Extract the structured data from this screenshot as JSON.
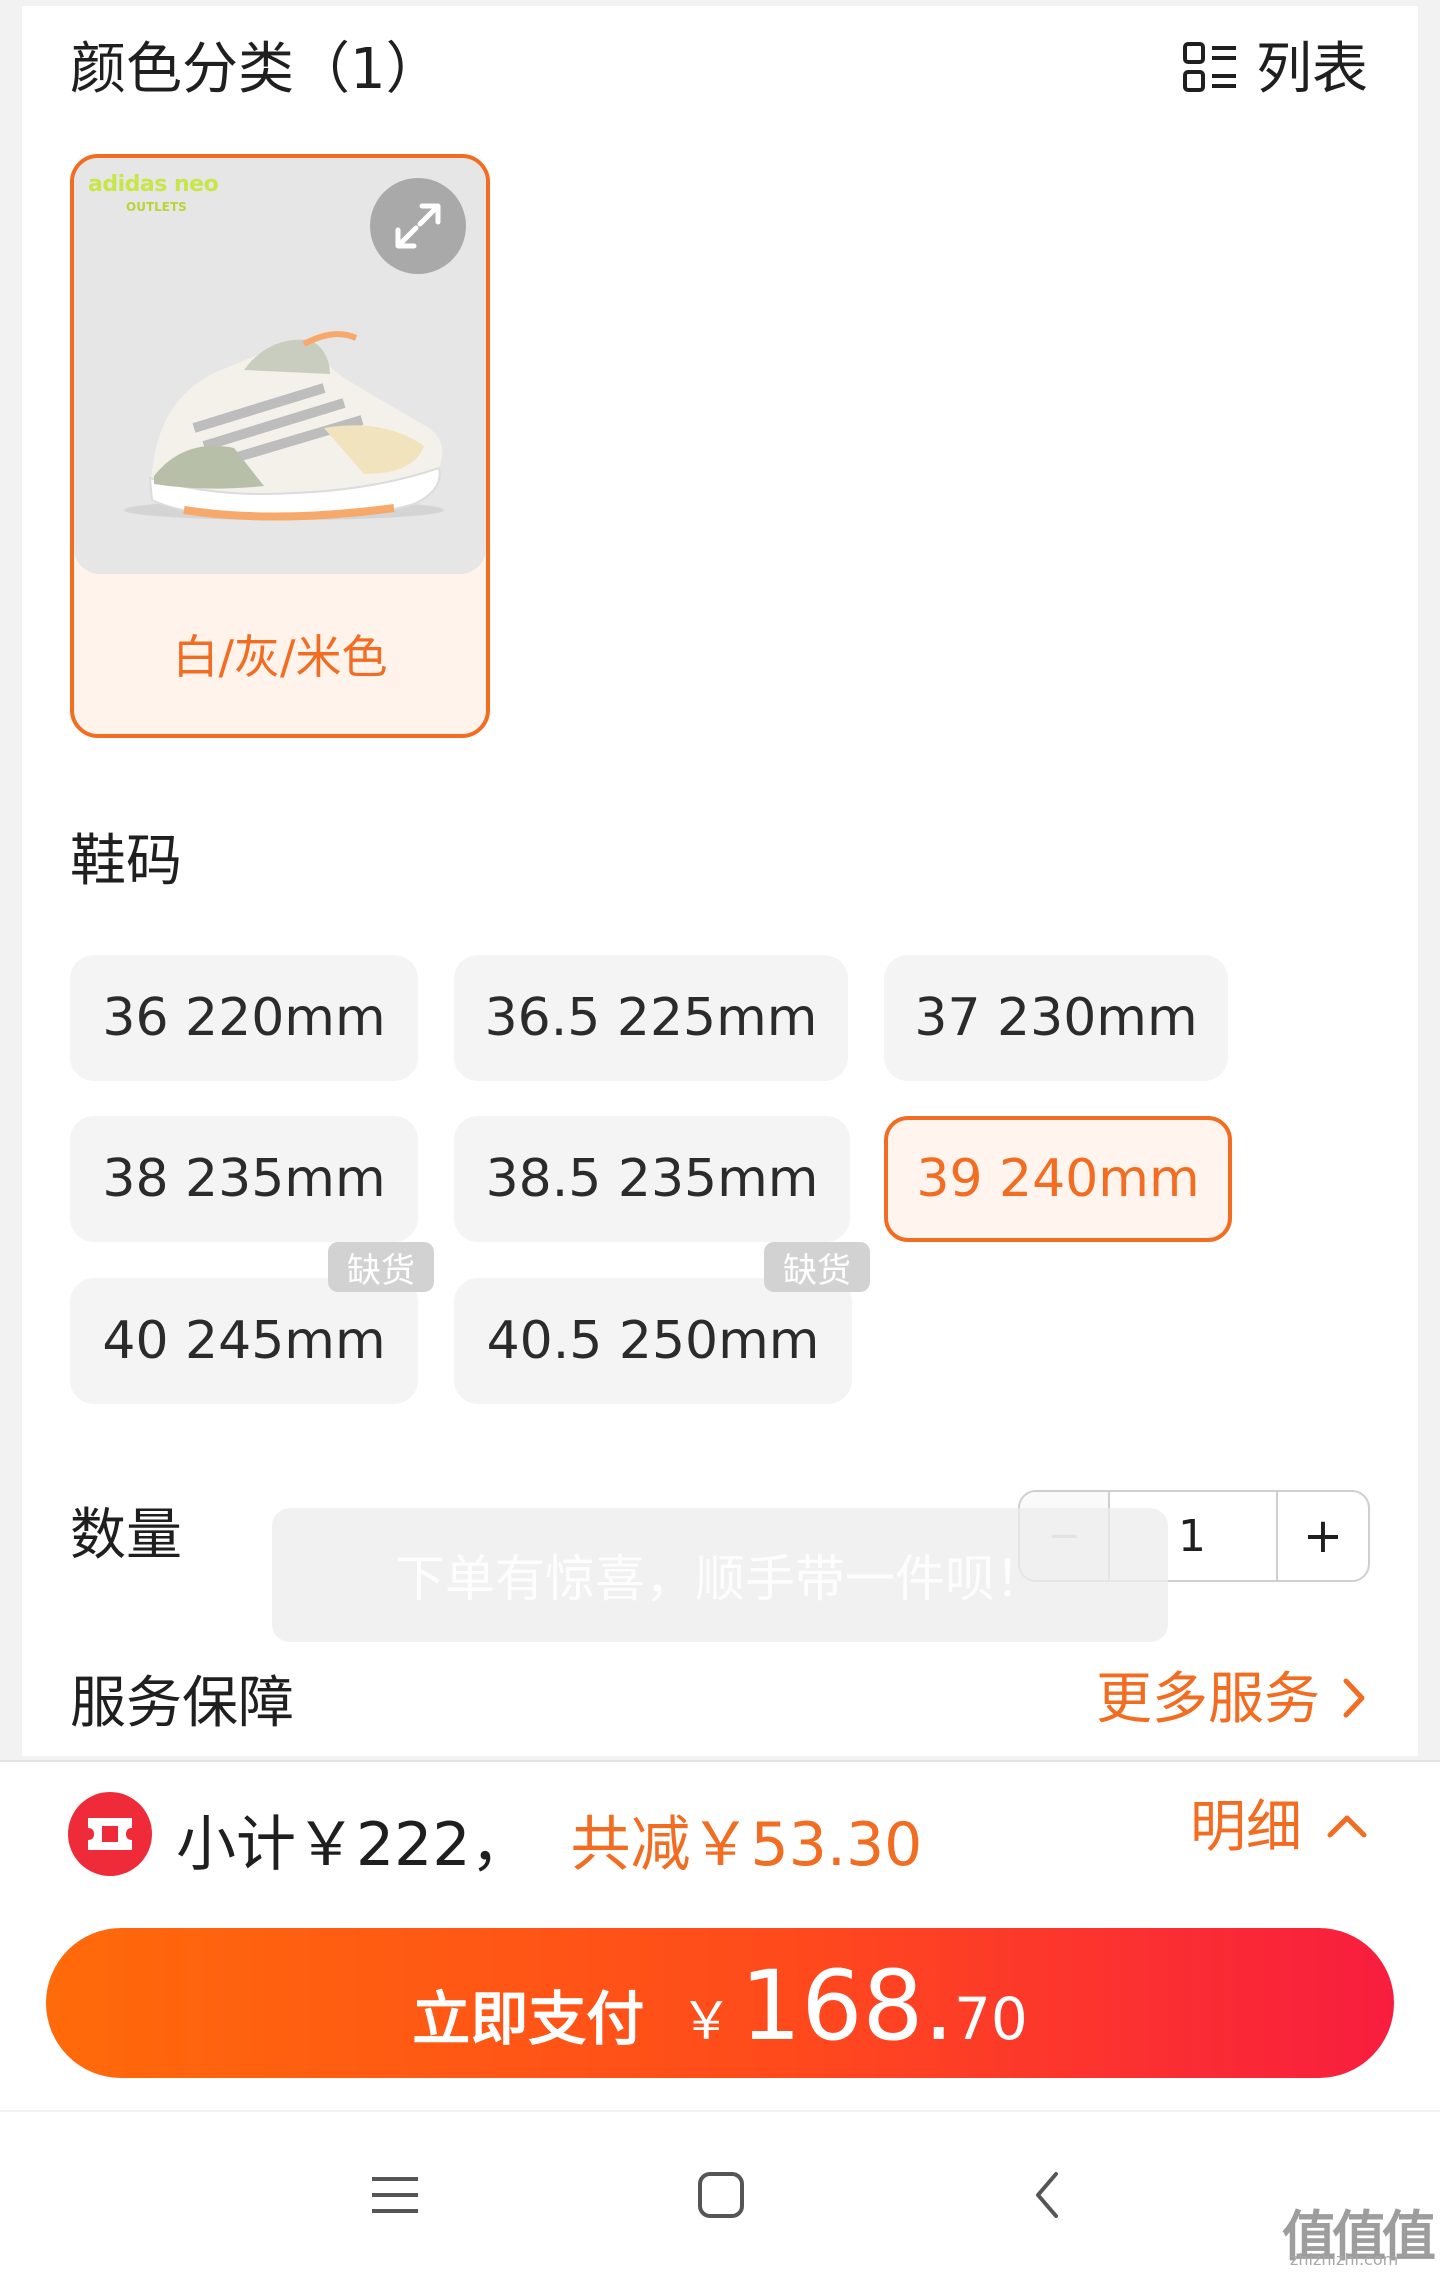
{
  "color_section": {
    "title": "颜色分类（1）",
    "view_toggle_label": "列表",
    "options": [
      {
        "name": "白/灰/米色",
        "brand": "adidas neo",
        "brand_sub": "OUTLETS",
        "selected": true
      }
    ]
  },
  "size_section": {
    "title": "鞋码",
    "sizes": [
      {
        "label": "36 220mm",
        "selected": false
      },
      {
        "label": "36.5 225mm",
        "selected": false
      },
      {
        "label": "37 230mm",
        "selected": false
      },
      {
        "label": "38 235mm",
        "selected": false
      },
      {
        "label": "38.5 235mm",
        "selected": false
      },
      {
        "label": "39 240mm",
        "selected": true
      },
      {
        "label": "40 245mm",
        "selected": false
      },
      {
        "label": "40.5 250mm",
        "selected": false
      }
    ],
    "out_of_stock_label": "缺货"
  },
  "quantity_section": {
    "title": "数量",
    "minus": "−",
    "value": "1",
    "plus": "+"
  },
  "toast": "下单有惊喜，顺手带一件呗！",
  "service_section": {
    "title": "服务保障",
    "more_label": "更多服务"
  },
  "summary": {
    "subtotal": "小计￥222，",
    "discount": "共减￥53.30",
    "detail_label": "明细"
  },
  "pay_button": {
    "label": "立即支付",
    "currency": "￥",
    "amount_int": "168.",
    "amount_dec": "70"
  },
  "watermark": {
    "text": "值值值",
    "sub": "zhizhizhi.com"
  },
  "colors": {
    "accent": "#f26d21",
    "coupon_red": "#ef2b3a"
  }
}
